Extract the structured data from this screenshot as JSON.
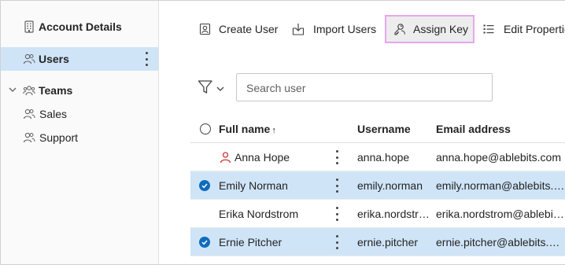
{
  "sidebar": {
    "account_details": "Account Details",
    "users": "Users",
    "teams": "Teams",
    "sales": "Sales",
    "support": "Support"
  },
  "toolbar": {
    "create_user": "Create User",
    "import_users": "Import Users",
    "assign_key": "Assign Key",
    "edit_properties": "Edit Properties"
  },
  "search": {
    "placeholder": "Search user"
  },
  "table": {
    "headers": {
      "full_name": "Full name",
      "sort_indicator": "↑",
      "username": "Username",
      "email": "Email address"
    },
    "rows": [
      {
        "full_name": "Anna Hope",
        "username": "anna.hope",
        "email": "anna.hope@ablebits.com",
        "selected": false,
        "icon": "person-icon"
      },
      {
        "full_name": "Emily Norman",
        "username": "emily.norman",
        "email": "emily.norman@ablebits.com",
        "selected": true
      },
      {
        "full_name": "Erika Nordstrom",
        "username": "erika.nordstrom",
        "email": "erika.nordstrom@ablebits.com",
        "selected": false
      },
      {
        "full_name": "Ernie Pitcher",
        "username": "ernie.pitcher",
        "email": "ernie.pitcher@ablebits.com",
        "selected": true
      }
    ]
  },
  "colors": {
    "selection": "#cfe4f7",
    "check": "#0f6cbd",
    "highlight_border": "#e6a6ec",
    "person_icon": "#d13438"
  }
}
